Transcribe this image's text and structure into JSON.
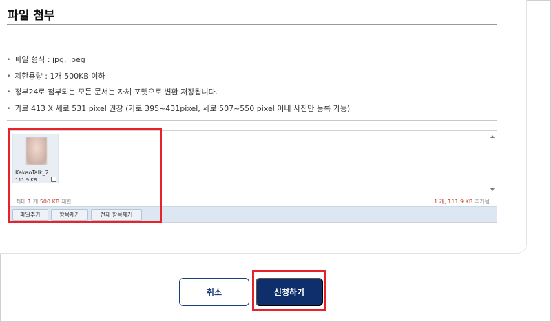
{
  "section": {
    "title": "파일 첨부"
  },
  "guide": {
    "bullet": "•",
    "items": [
      "파일 형식 : jpg, jpeg",
      "제한용량 : 1개 500KB 이하",
      "정부24로 첨부되는 모든 문서는 자체 포맷으로 변환 저장됩니다.",
      "가로 413 X 세로 531 pixel 권장 (가로 395~431pixel, 세로 507~550 pixel 이내 사진만 등록 가능)"
    ]
  },
  "uploader": {
    "file": {
      "name": "KakaoTalk_2…",
      "size": "111.9 KB",
      "checked": false
    },
    "limit": {
      "prefix": "최대",
      "count": "1",
      "unit": "개",
      "size": "500 KB",
      "suffix": "제한"
    },
    "total": {
      "count": "1",
      "unit": "개,",
      "size": "111.9 KB",
      "suffix": "추가됨"
    },
    "buttons": {
      "add": "파일추가",
      "remove": "항목제거",
      "remove_all": "전체 항목제거"
    }
  },
  "actions": {
    "cancel": "취소",
    "apply": "신청하기"
  },
  "colors": {
    "primary": "#0e2f6b",
    "highlight": "#e8212b",
    "accent_red": "#c0392b"
  }
}
